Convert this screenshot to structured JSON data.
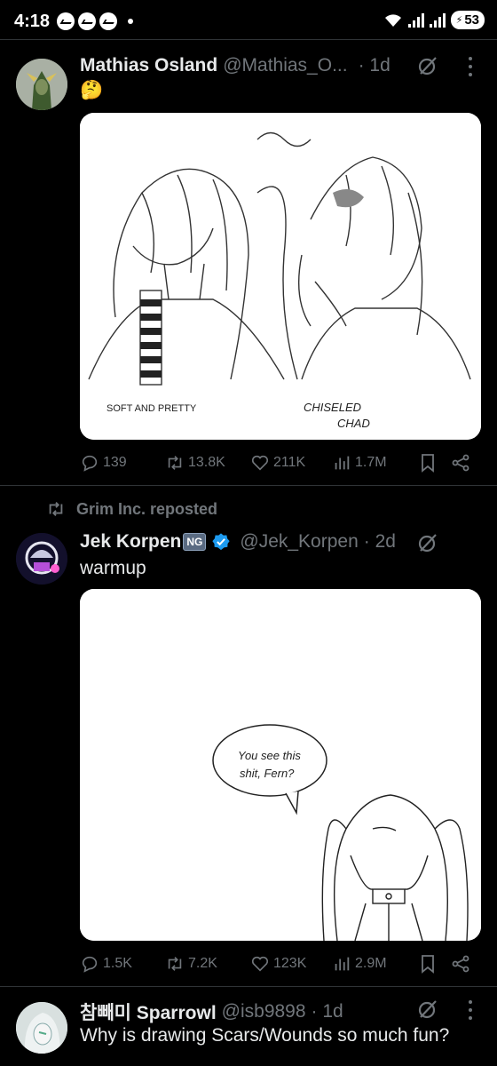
{
  "status_bar": {
    "time": "4:18",
    "battery": "53"
  },
  "tweets": [
    {
      "name": "Mathias Osland",
      "handle": "@Mathias_O...",
      "time": "· 1d",
      "text": "🤔",
      "art_left_label": "SOFT AND PRETTY",
      "art_right_label_1": "CHISELED",
      "art_right_label_2": "CHAD",
      "stats": {
        "replies": "139",
        "reposts": "13.8K",
        "likes": "211K",
        "views": "1.7M"
      }
    },
    {
      "repost_label": "Grim Inc. reposted",
      "name": "Jek Korpen",
      "badge": "NG",
      "handle": "@Jek_Korpen",
      "time": "· 2d",
      "text": "warmup",
      "speech_1": "You see this",
      "speech_2": "shit, Fern?",
      "stats": {
        "replies": "1.5K",
        "reposts": "7.2K",
        "likes": "123K",
        "views": "2.9M"
      }
    },
    {
      "name": "참빼미 Sparrowl",
      "handle": "@isb9898",
      "time": "· 1d",
      "text": "Why is drawing Scars/Wounds so much fun?"
    }
  ],
  "colors": {
    "background": "#000000",
    "text": "#e7e9ea",
    "muted": "#71767b",
    "divider": "#2f3336",
    "verified": "#1d9bf0"
  }
}
